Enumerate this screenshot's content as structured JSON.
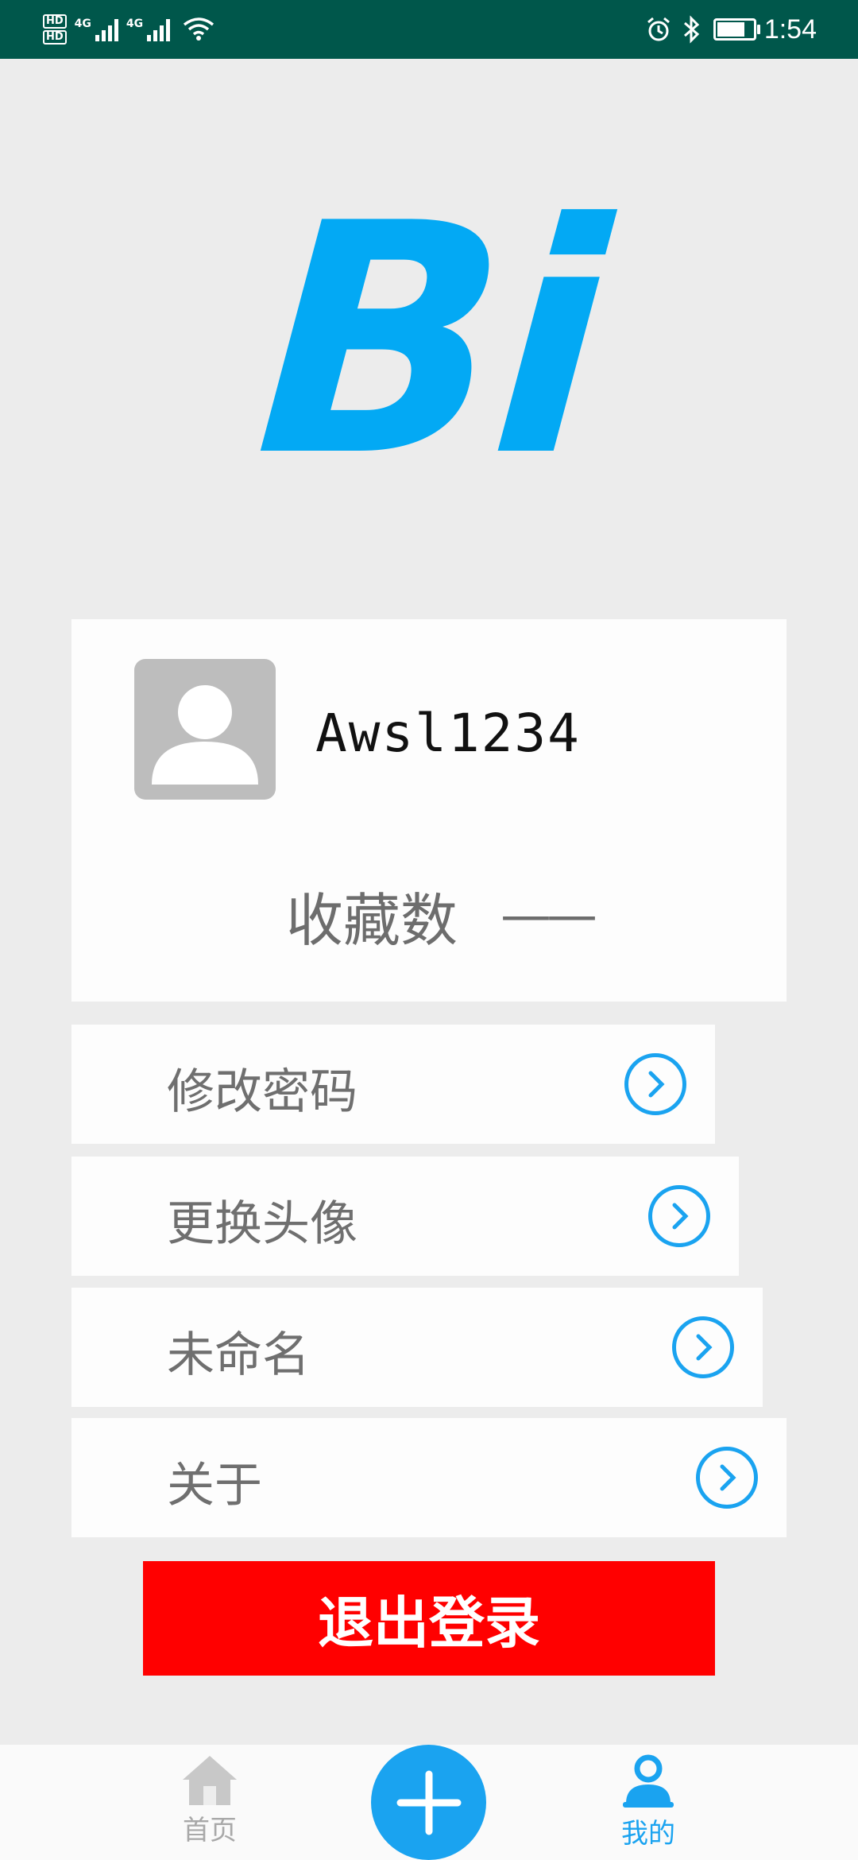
{
  "status_bar": {
    "hd_labels": [
      "HD",
      "HD"
    ],
    "net1": "4G",
    "net2": "4G",
    "time": "1:54",
    "icons": [
      "alarm-icon",
      "bluetooth-icon",
      "battery-charging-icon",
      "wifi-icon",
      "signal-icon"
    ]
  },
  "logo": {
    "text": "Bi",
    "color": "#03a9f4"
  },
  "profile": {
    "username": "Awsl1234",
    "favorites_label": "收藏数",
    "favorites_value": "——"
  },
  "menu": {
    "items": [
      {
        "label": "修改密码"
      },
      {
        "label": "更换头像"
      },
      {
        "label": "未命名"
      },
      {
        "label": "关于"
      }
    ]
  },
  "logout": {
    "label": "退出登录",
    "color": "#ff0000"
  },
  "bottom_nav": {
    "home_label": "首页",
    "mine_label": "我的",
    "active": "我的",
    "accent_color": "#1aa3f0",
    "inactive_color": "#b5b5b5"
  }
}
